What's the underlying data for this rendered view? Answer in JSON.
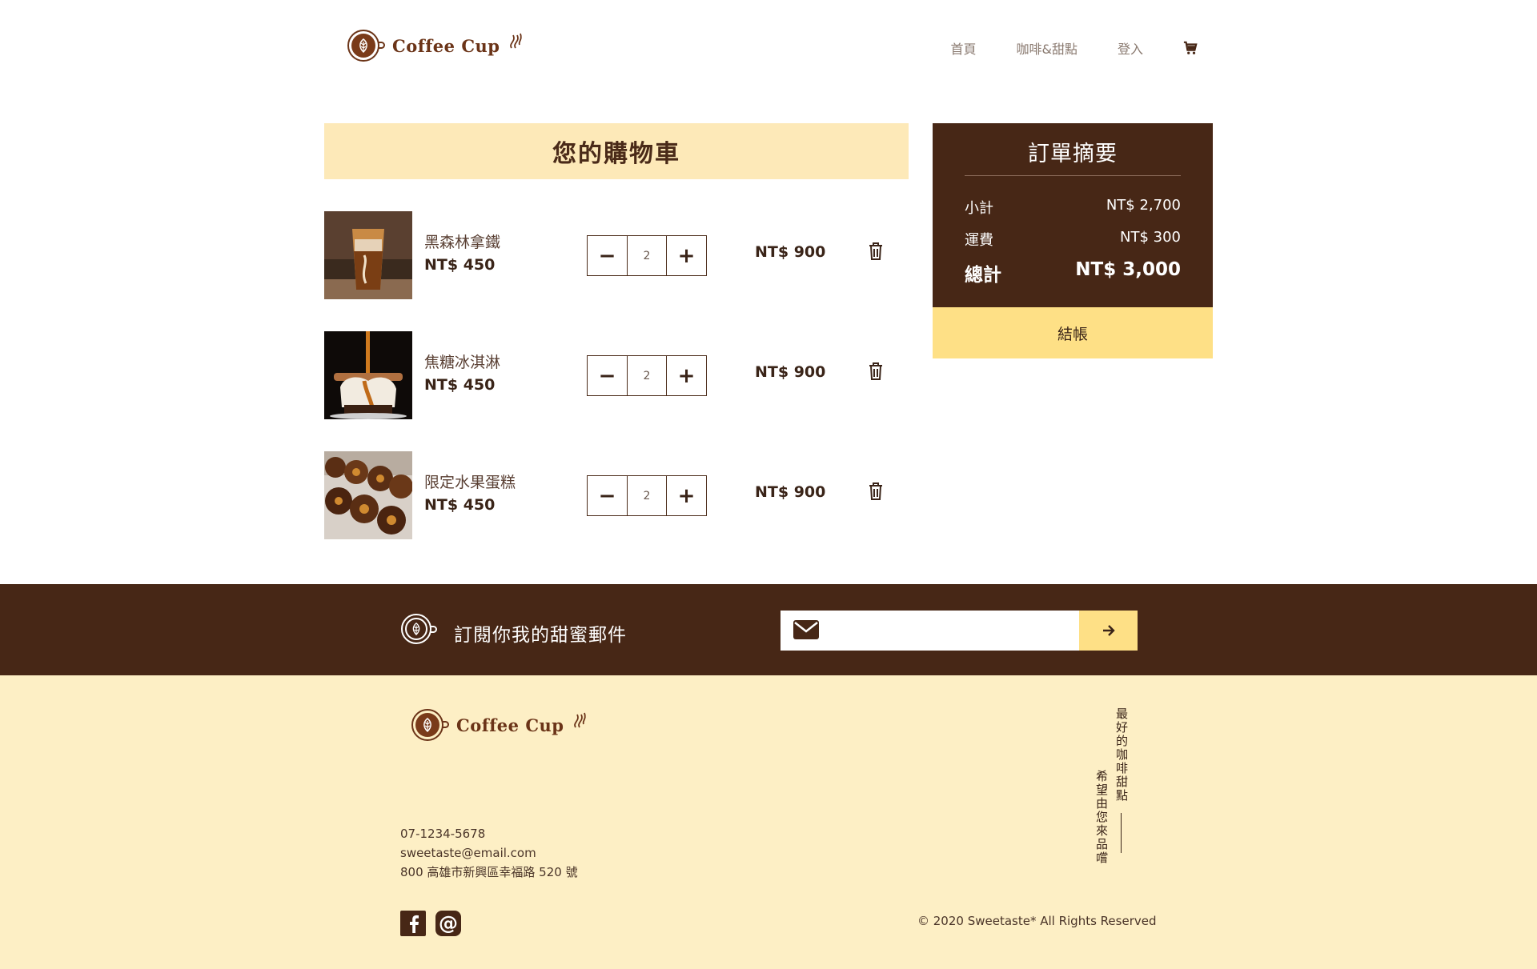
{
  "header": {
    "logo_text": "Coffee Cup",
    "nav": {
      "home": "首頁",
      "menu": "咖啡&甜點",
      "login": "登入"
    }
  },
  "cart": {
    "title": "您的購物車",
    "items": [
      {
        "name": "黑森林拿鐵",
        "price": "NT$ 450",
        "qty": "2",
        "subtotal": "NT$ 900"
      },
      {
        "name": "焦糖冰淇淋",
        "price": "NT$ 450",
        "qty": "2",
        "subtotal": "NT$ 900"
      },
      {
        "name": "限定水果蛋糕",
        "price": "NT$ 450",
        "qty": "2",
        "subtotal": "NT$ 900"
      }
    ],
    "minus_label": "−",
    "plus_label": "+"
  },
  "summary": {
    "title": "訂單摘要",
    "subtotal_label": "小計",
    "subtotal_value": "NT$ 2,700",
    "shipping_label": "運費",
    "shipping_value": "NT$ 300",
    "total_label": "總計",
    "total_value": "NT$ 3,000",
    "checkout_label": "結帳"
  },
  "subscribe": {
    "text": "訂閱你我的甜蜜郵件",
    "placeholder": ""
  },
  "footer": {
    "logo_text": "Coffee Cup",
    "phone": "07-1234-5678",
    "email": "sweetaste@email.com",
    "address": "800 高雄市新興區幸福路 520 號",
    "slogan_1": "最好的咖啡甜點",
    "slogan_2": "希望由您來品嚐",
    "copyright": "© 2020 Sweetaste* All Rights Reserved"
  },
  "colors": {
    "brown": "#472716",
    "cream": "#fdefc5",
    "yellow": "#fee086",
    "title_bg": "#fde9b8"
  }
}
